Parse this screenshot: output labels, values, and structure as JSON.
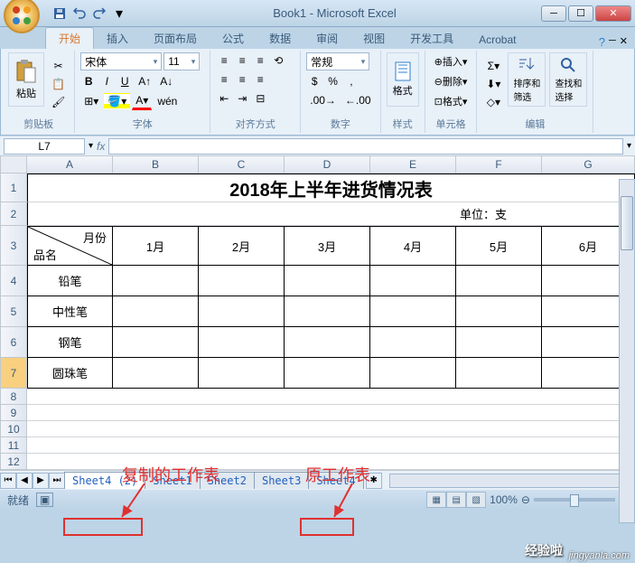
{
  "window": {
    "title": "Book1 - Microsoft Excel"
  },
  "tabs": {
    "home": "开始",
    "insert": "插入",
    "layout": "页面布局",
    "formula": "公式",
    "data": "数据",
    "review": "审阅",
    "view": "视图",
    "dev": "开发工具",
    "acrobat": "Acrobat"
  },
  "ribbon": {
    "clipboard": {
      "label": "剪贴板",
      "paste": "粘贴"
    },
    "font": {
      "label": "字体",
      "name": "宋体",
      "size": "11"
    },
    "align": {
      "label": "对齐方式"
    },
    "number": {
      "label": "数字",
      "format": "常规"
    },
    "styles": {
      "label": "样式",
      "fmt": "格式"
    },
    "cells": {
      "label": "单元格",
      "insert": "插入",
      "delete": "删除",
      "format": "格式"
    },
    "edit": {
      "label": "编辑",
      "sort": "排序和\n筛选",
      "find": "查找和\n选择"
    }
  },
  "formula_bar": {
    "name": "L7",
    "fx": "fx"
  },
  "columns": [
    "A",
    "B",
    "C",
    "D",
    "E",
    "F",
    "G"
  ],
  "rows": [
    "1",
    "2",
    "3",
    "4",
    "5",
    "6",
    "7",
    "8",
    "9",
    "10",
    "11",
    "12"
  ],
  "sheet": {
    "title": "2018年上半年进货情况表",
    "unit": "单位：支",
    "diag_top": "月份",
    "diag_bottom": "品名",
    "months": [
      "1月",
      "2月",
      "3月",
      "4月",
      "5月",
      "6月"
    ],
    "items": [
      "铅笔",
      "中性笔",
      "钢笔",
      "圆珠笔"
    ]
  },
  "sheets": {
    "s4copy": "Sheet4 (2)",
    "s1": "Sheet1",
    "s2": "Sheet2",
    "s3": "Sheet3",
    "s4": "Sheet4"
  },
  "status": {
    "ready": "就绪",
    "zoom": "100%"
  },
  "annotations": {
    "copied": "复制的工作表",
    "original": "原工作表"
  },
  "watermark": {
    "brand": "经验啦",
    "url": "jingyanla.com"
  }
}
